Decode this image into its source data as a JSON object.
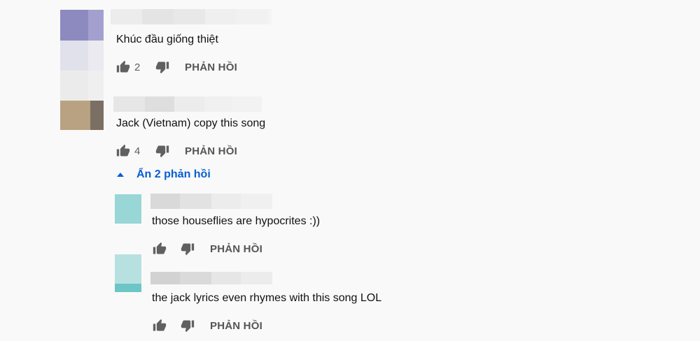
{
  "comments": [
    {
      "text": "Khúc đầu giống thiệt",
      "like_count": "2",
      "reply_label": "PHẢN HỒI"
    },
    {
      "text": "Jack (Vietnam) copy this song",
      "like_count": "4",
      "reply_label": "PHẢN HỒI",
      "replies_toggle": "Ẩn 2 phản hồi",
      "replies": [
        {
          "text": "those houseflies are hypocrites :))",
          "like_count": "",
          "reply_label": "PHẢN HỒI"
        },
        {
          "text": "the jack lyrics even rhymes with this song LOL",
          "like_count": "",
          "reply_label": "PHẢN HỒI"
        }
      ]
    }
  ],
  "icons": {
    "like": "thumbs-up-icon",
    "dislike": "thumbs-down-icon",
    "collapse": "caret-up-icon"
  },
  "colors": {
    "link": "#065fd4",
    "text": "#111111",
    "secondary": "#606060"
  }
}
